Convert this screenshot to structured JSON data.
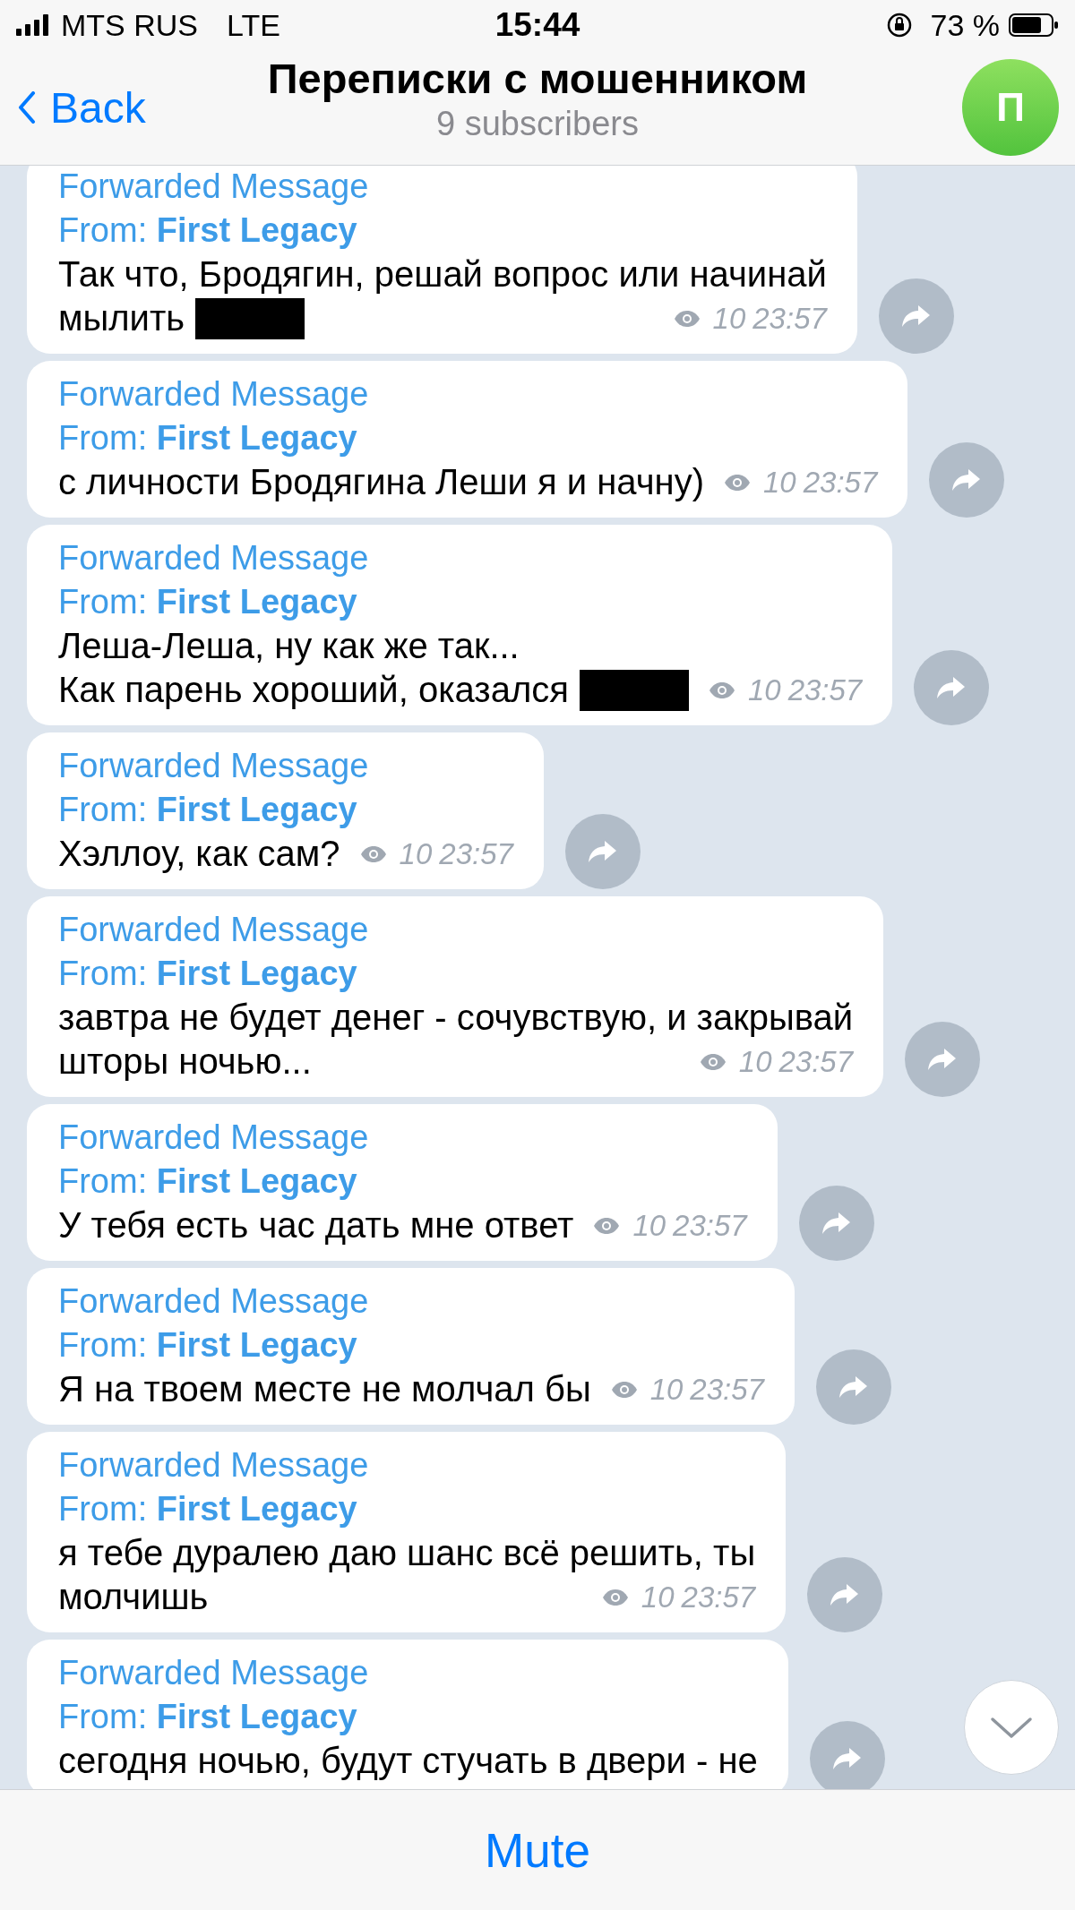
{
  "status_bar": {
    "carrier": "MTS RUS",
    "network": "LTE",
    "time": "15:44",
    "battery": "73 %"
  },
  "header": {
    "back": "Back",
    "title": "Переписки с мошенником",
    "subtitle": "9 subscribers",
    "avatar_letter": "П"
  },
  "messages": [
    {
      "forwarded_label": "Forwarded Message",
      "from": "From: **First Legacy**",
      "text": "Так что, Бродягин, решай вопрос или начинай\nмылить",
      "redacted": true,
      "views": "10",
      "time": "23:57"
    },
    {
      "forwarded_label": "Forwarded Message",
      "from": "From: **First Legacy**",
      "text": "с личности Бродягина Леши я и начну)",
      "redacted": false,
      "views": "10",
      "time": "23:57"
    },
    {
      "forwarded_label": "Forwarded Message",
      "from": "From: **First Legacy**",
      "text": "Леша-Леша, ну как же так...\nКак парень хороший, оказался",
      "redacted": true,
      "views": "10",
      "time": "23:57"
    },
    {
      "forwarded_label": "Forwarded Message",
      "from": "From: **First Legacy**",
      "text": "Хэллоу, как сам?",
      "redacted": false,
      "views": "10",
      "time": "23:57"
    },
    {
      "forwarded_label": "Forwarded Message",
      "from": "From: **First Legacy**",
      "text": "завтра не будет денег - сочувствую, и закрывай\nшторы ночью...",
      "redacted": false,
      "views": "10",
      "time": "23:57"
    },
    {
      "forwarded_label": "Forwarded Message",
      "from": "From: **First Legacy**",
      "text": "У тебя есть час дать мне ответ",
      "redacted": false,
      "views": "10",
      "time": "23:57"
    },
    {
      "forwarded_label": "Forwarded Message",
      "from": "From: **First Legacy**",
      "text": "Я на твоем месте не молчал бы",
      "redacted": false,
      "views": "10",
      "time": "23:57"
    },
    {
      "forwarded_label": "Forwarded Message",
      "from": "From: **First Legacy**",
      "text": "я тебе дуралею даю шанс всё решить, ты\nмолчишь",
      "redacted": false,
      "views": "10",
      "time": "23:57"
    },
    {
      "forwarded_label": "Forwarded Message",
      "from": "From: **First Legacy**",
      "text": "сегодня ночью, будут стучать в двери - не",
      "redacted": false
    }
  ],
  "bottom_bar": {
    "button": "Mute"
  }
}
